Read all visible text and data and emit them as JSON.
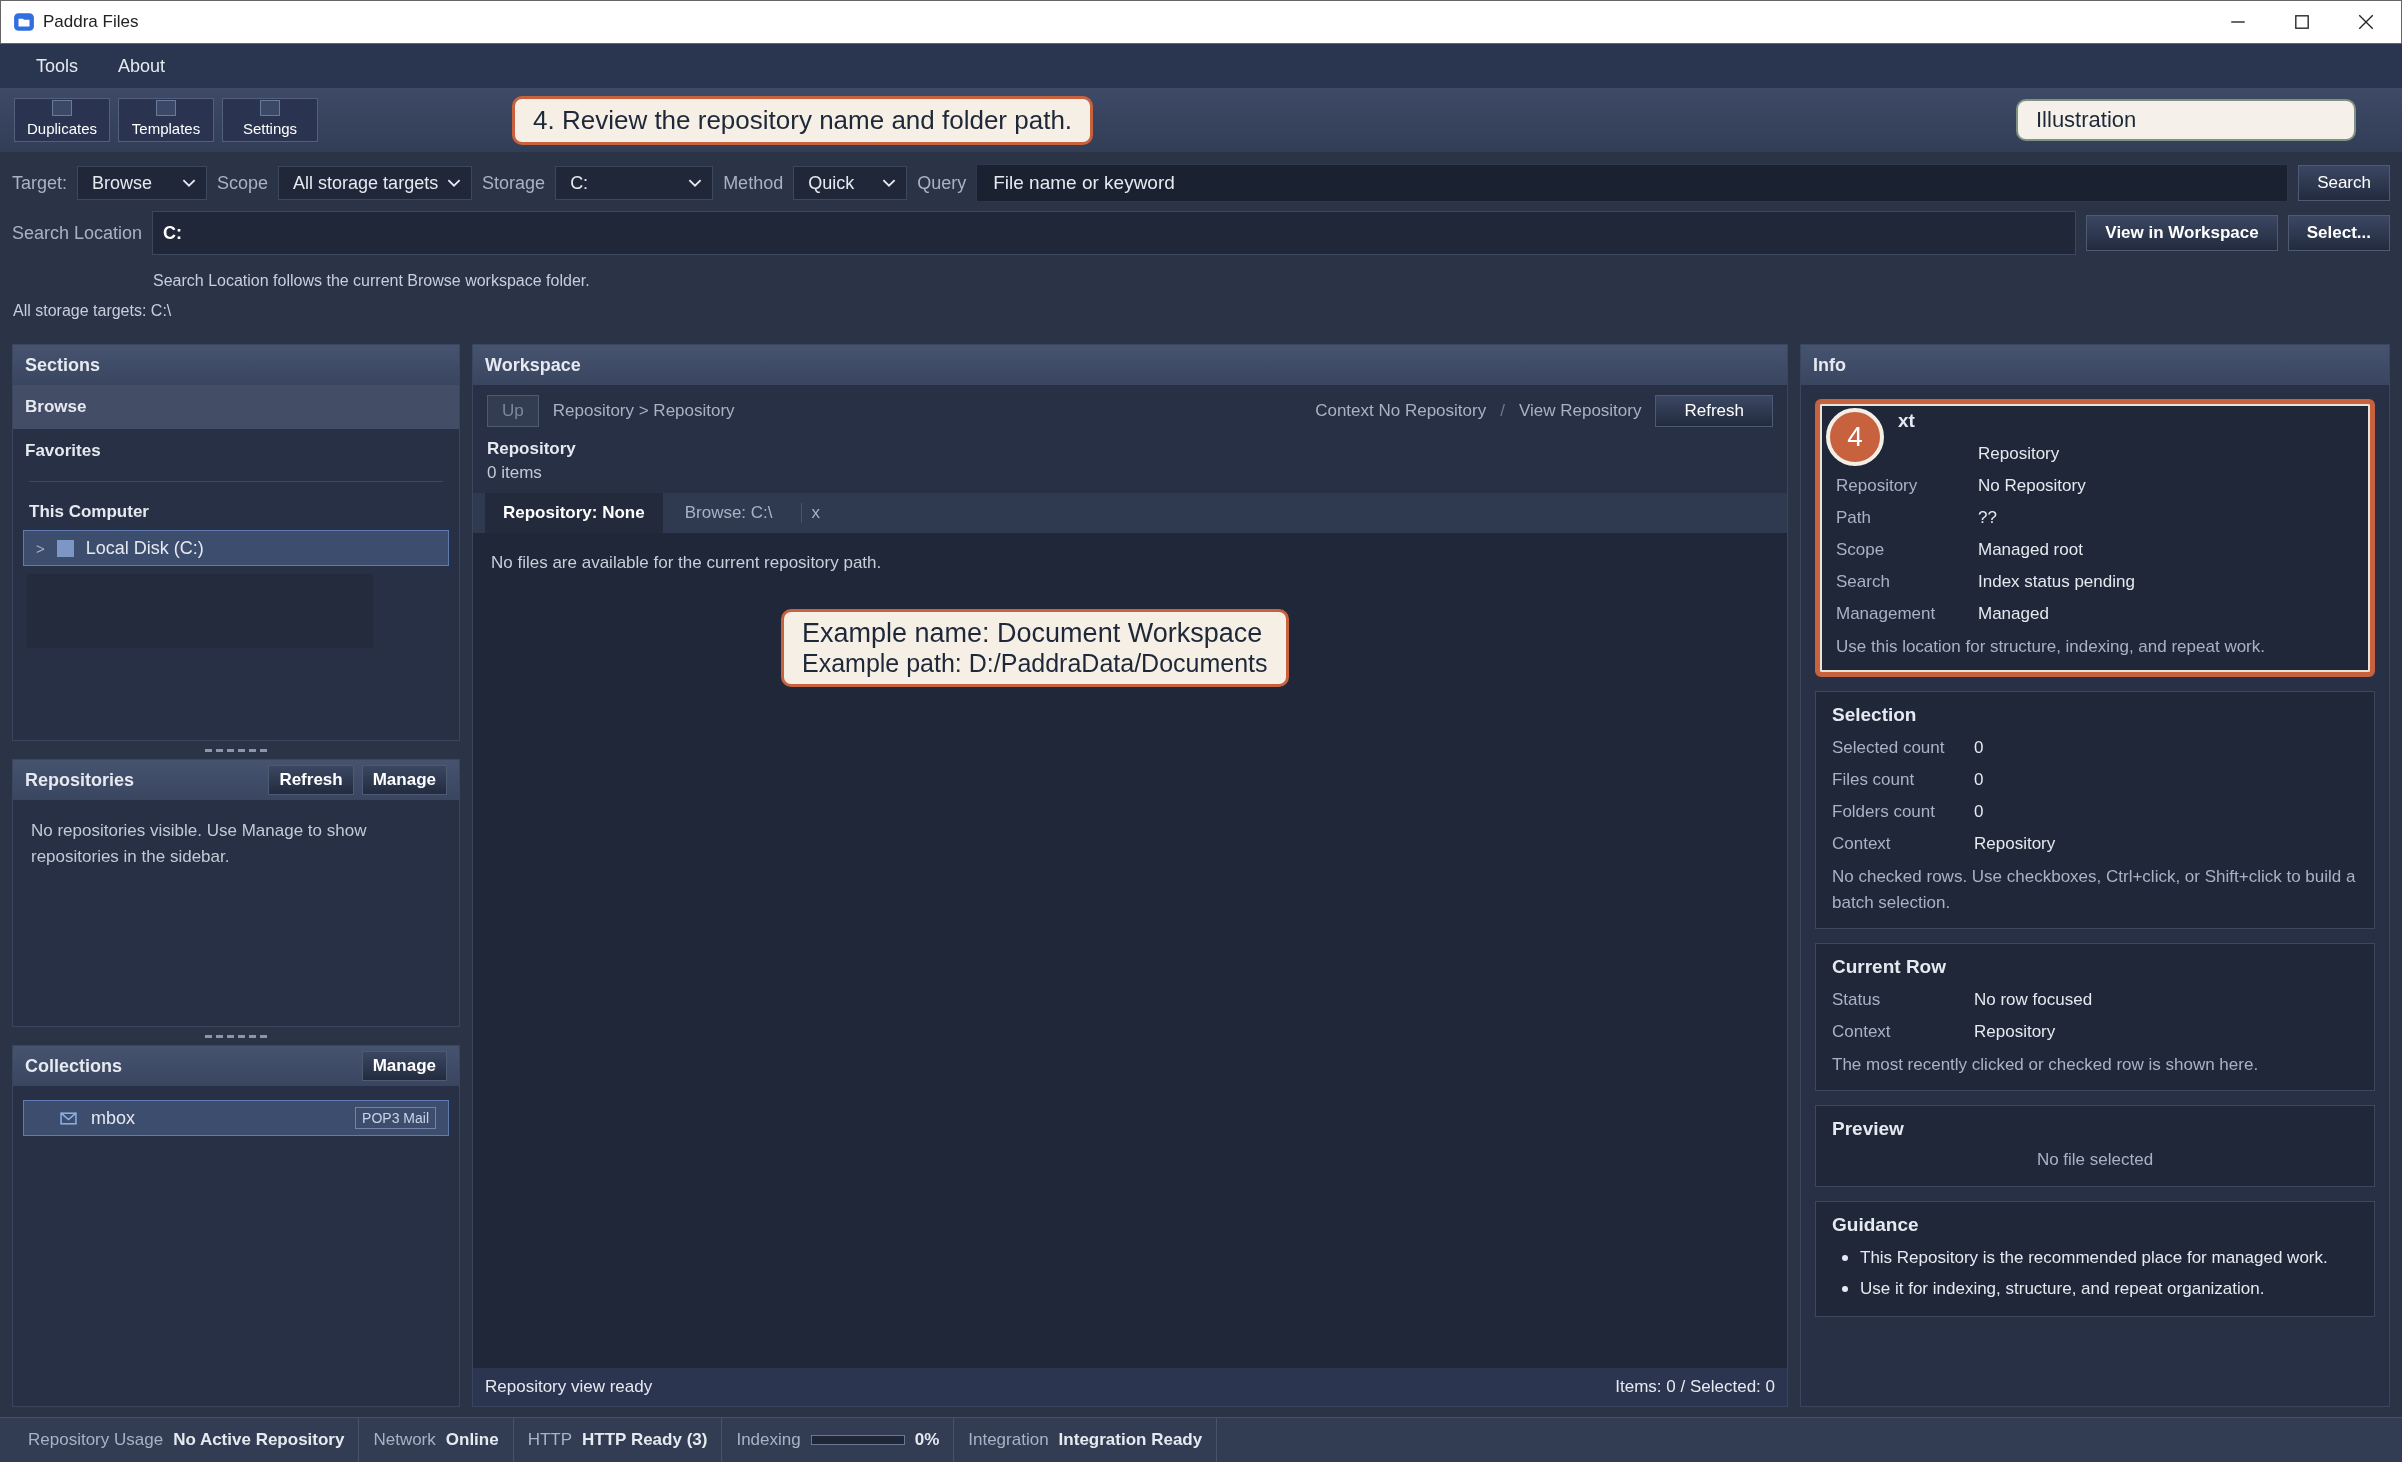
{
  "window": {
    "title": "Paddra Files"
  },
  "menu": [
    "Tools",
    "About"
  ],
  "toolbar": [
    {
      "label": "Duplicates"
    },
    {
      "label": "Templates"
    },
    {
      "label": "Settings"
    }
  ],
  "step_callout": "4. Review the repository name and folder path.",
  "illustration_label": "Illustration",
  "filters": [
    {
      "label": "Target:",
      "value": "Browse"
    },
    {
      "label": "Scope",
      "value": "All storage targets"
    },
    {
      "label": "Storage",
      "value": "C:"
    },
    {
      "label": "Method",
      "value": "Quick"
    }
  ],
  "query": {
    "label": "Query",
    "placeholder": "File name or keyword"
  },
  "search_button": "Search",
  "location": {
    "label": "Search Location",
    "value": "C:",
    "buttons": [
      "View in Workspace",
      "Select..."
    ],
    "hint": "Search Location follows the current Browse workspace folder."
  },
  "storage_summary": "All storage targets: C:\\",
  "sections": {
    "title": "Sections",
    "items": [
      {
        "label": "Browse",
        "selected": true
      },
      {
        "label": "Favorites",
        "selected": false
      }
    ],
    "group": "This Computer",
    "tree": [
      {
        "toggle": ">",
        "label": "Local Disk (C:)",
        "selected": true
      }
    ]
  },
  "repositories": {
    "title": "Repositories",
    "buttons": [
      "Refresh",
      "Manage"
    ],
    "message": "No repositories visible. Use Manage to show repositories in the sidebar."
  },
  "collections": {
    "title": "Collections",
    "buttons": [
      "Manage"
    ],
    "items": [
      {
        "label": "mbox",
        "tag": "POP3 Mail",
        "selected": true
      }
    ]
  },
  "workspace": {
    "title": "Workspace",
    "up": {
      "label": "Up",
      "disabled": true
    },
    "breadcrumb": "Repository > Repository",
    "context": "Context No Repository",
    "separator": "/",
    "view": "View Repository",
    "refresh": "Refresh",
    "heading": "Repository",
    "count": "0 items",
    "tabs": [
      {
        "label": "Repository: None",
        "selected": true
      },
      {
        "label": "Browse: C:\\",
        "selected": false
      }
    ],
    "close_tab": "x",
    "empty_message": "No files are available for the current repository path.",
    "example": [
      "Example name: Document Workspace",
      "Example path: D:/PaddraData/Documents"
    ],
    "status": "Repository view ready",
    "counts": "Items: 0 / Selected: 0"
  },
  "info": {
    "title": "Info",
    "cards": [
      {
        "kind": "details",
        "title": "xt",
        "highlighted": true,
        "badge": "4",
        "rows": [
          {
            "value": "Repository"
          },
          {
            "label": "Repository",
            "value": "No Repository"
          },
          {
            "label": "Path",
            "value": "??"
          },
          {
            "label": "Scope",
            "value": "Managed root"
          },
          {
            "label": "Search",
            "value": "Index status pending"
          },
          {
            "label": "Management",
            "value": "Managed"
          }
        ],
        "note": "Use this location for structure, indexing, and repeat work."
      },
      {
        "kind": "details",
        "title": "Selection",
        "highlighted": false,
        "rows": [
          {
            "label": "Selected count",
            "value": "0"
          },
          {
            "label": "Files count",
            "value": "0"
          },
          {
            "label": "Folders count",
            "value": "0"
          },
          {
            "label": "Context",
            "value": "Repository"
          }
        ],
        "note": "No checked rows. Use checkboxes, Ctrl+click, or Shift+click to build a batch selection."
      },
      {
        "kind": "details",
        "title": "Current Row",
        "highlighted": false,
        "rows": [
          {
            "label": "Status",
            "value": "No row focused"
          },
          {
            "label": "Context",
            "value": "Repository"
          }
        ],
        "note": "The most recently clicked or checked row is shown here."
      },
      {
        "kind": "message",
        "title": "Preview",
        "highlighted": false,
        "message": "No file selected"
      },
      {
        "kind": "bullets",
        "title": "Guidance",
        "highlighted": false,
        "bullets": [
          "This Repository is the recommended place for managed work.",
          "Use it for indexing, structure, and repeat organization."
        ]
      }
    ]
  },
  "status_bar": [
    {
      "kind": "text",
      "label": "Repository Usage",
      "value": "No Active Repository"
    },
    {
      "kind": "text",
      "label": "Network",
      "value": "Online"
    },
    {
      "kind": "text",
      "label": "HTTP",
      "value": "HTTP Ready (3)"
    },
    {
      "kind": "meter",
      "label": "Indexing",
      "level": 0,
      "value": "0%"
    },
    {
      "kind": "text",
      "label": "Integration",
      "value": "Integration Ready"
    }
  ]
}
